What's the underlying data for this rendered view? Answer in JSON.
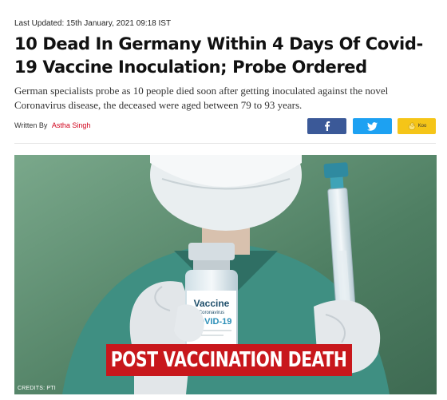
{
  "article": {
    "updated": "Last Updated: 15th January, 2021 09:18 IST",
    "headline": "10 Dead In Germany Within 4 Days Of Covid-19 Vaccine Inoculation; Probe Ordered",
    "summary": "German specialists probe as 10 people died soon after getting inoculated against the novel Coronavirus disease, the deceased were aged between 79 to 93 years.",
    "byline_prefix": "Written By",
    "author": "Astha Singh"
  },
  "share": {
    "facebook_icon": "facebook-icon",
    "twitter_icon": "twitter-icon",
    "koo_icon": "koo-bird-icon",
    "koo_label": "Koo",
    "colors": {
      "facebook": "#3b5998",
      "twitter": "#1da1f2",
      "koo": "#f5c518"
    }
  },
  "image": {
    "vial_label_top": "Vaccine",
    "vial_label_sub": "Coronavirus",
    "vial_label_main": "COVID-19",
    "banner_text": "POST VACCINATION DEATH",
    "credits": "CREDITS: PTI",
    "banner_color": "#c8171c"
  }
}
